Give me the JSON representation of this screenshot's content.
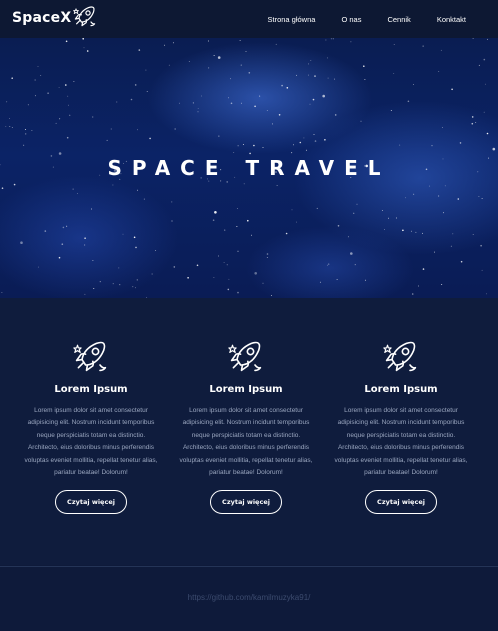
{
  "nav": {
    "logo": "SpaceX",
    "items": [
      {
        "label": "Strona główna"
      },
      {
        "label": "O nas"
      },
      {
        "label": "Cennik"
      },
      {
        "label": "Konktakt"
      }
    ]
  },
  "hero": {
    "title": "SPACE TRAVEL"
  },
  "features": [
    {
      "icon": "rocket-icon",
      "title": "Lorem Ipsum",
      "text": "Lorem ipsum dolor sit amet consectetur adipisicing elit. Nostrum incidunt temporibus neque perspiciatis totam ea distinctio. Architecto, eius doloribus minus perferendis voluptas eveniet mollitia, repellat tenetur alias, pariatur beatae! Dolorum!",
      "button": "Czytaj więcej"
    },
    {
      "icon": "rocket-icon",
      "title": "Lorem Ipsum",
      "text": "Lorem ipsum dolor sit amet consectetur adipisicing elit. Nostrum incidunt temporibus neque perspiciatis totam ea distinctio. Architecto, eius doloribus minus perferendis voluptas eveniet mollitia, repellat tenetur alias, pariatur beatae! Dolorum!",
      "button": "Czytaj więcej"
    },
    {
      "icon": "rocket-icon",
      "title": "Lorem Ipsum",
      "text": "Lorem ipsum dolor sit amet consectetur adipisicing elit. Nostrum incidunt temporibus neque perspiciatis totam ea distinctio. Architecto, eius doloribus minus perferendis voluptas eveniet mollitia, repellat tenetur alias, pariatur beatae! Dolorum!",
      "button": "Czytaj więcej"
    }
  ],
  "footer": {
    "link": "https://github.com/kamilmuzyka91/"
  },
  "colors": {
    "nav_bg": "#0d1833",
    "section_bg": "#0f1c3d",
    "hero_blue": "#0b2366",
    "muted_text": "#9aa6bf",
    "footer_link": "#3c4b6e"
  }
}
